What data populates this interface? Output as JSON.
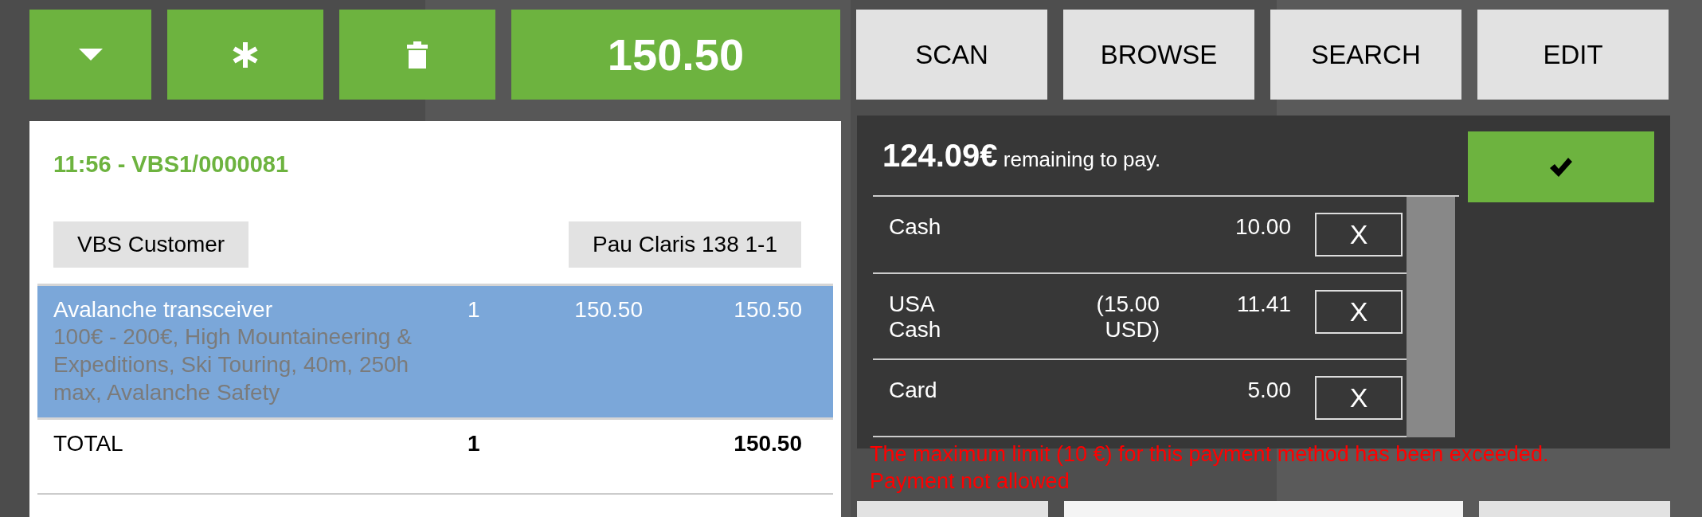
{
  "toolbar": [
    {
      "kind": "dropdown"
    },
    {
      "kind": "asterisk"
    },
    {
      "kind": "trash"
    },
    {
      "kind": "total",
      "label": "150.50"
    }
  ],
  "actions": [
    "SCAN",
    "BROWSE",
    "SEARCH",
    "EDIT"
  ],
  "receipt": {
    "title": "11:56 - VBS1/0000081",
    "customer": "VBS Customer",
    "address": "Pau Claris 138 1-1",
    "lines": [
      {
        "name": "Avalanche transceiver",
        "details": "100€ - 200€, High Mountaineering & Expeditions, Ski Touring, 40m, 250h max, Avalanche Safety",
        "qty": "1",
        "price": "150.50",
        "total": "150.50",
        "selected": true
      }
    ],
    "total_row": {
      "label": "TOTAL",
      "qty": "1",
      "amount": "150.50"
    }
  },
  "payment": {
    "remaining": "124.09€",
    "remaining_text": "remaining to pay.",
    "payments": [
      {
        "method": "Cash",
        "amount": "10.00",
        "remove": "X"
      },
      {
        "method": "USA Cash",
        "foreign": "(15.00 USD)",
        "amount": "11.41",
        "remove": "X"
      },
      {
        "method": "Card",
        "amount": "5.00",
        "remove": "X"
      }
    ],
    "error": "The maximum limit (10 €) for this payment method has been exceeded. Payment not allowed"
  }
}
